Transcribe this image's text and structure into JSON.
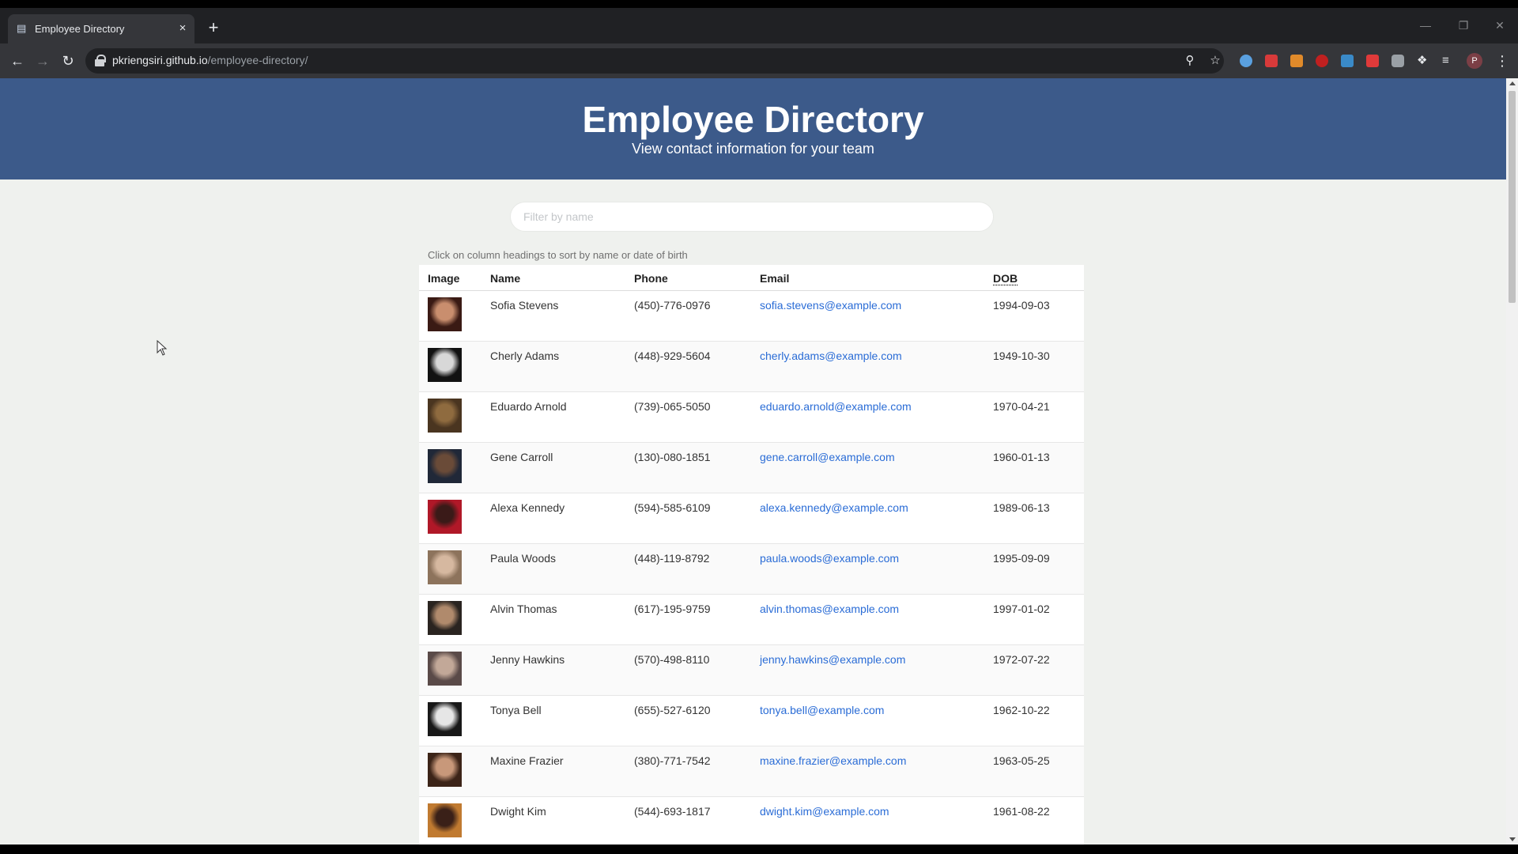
{
  "browser": {
    "tab_title": "Employee Directory",
    "tab_close": "×",
    "new_tab": "+",
    "url_host": "pkriengsiri.github.io",
    "url_path": "/employee-directory/",
    "profile_initial": "P",
    "window_min": "—",
    "window_restore": "❐",
    "window_close": "✕"
  },
  "page": {
    "title": "Employee Directory",
    "subtitle": "View contact information for your team",
    "search_placeholder": "Filter by name",
    "search_value": "",
    "hint": "Click on column headings to sort by name or date of birth"
  },
  "table": {
    "headers": {
      "image": "Image",
      "name": "Name",
      "phone": "Phone",
      "email": "Email",
      "dob": "DOB"
    },
    "rows": [
      {
        "name": "Sofia Stevens",
        "phone": "(450)-776-0976",
        "email": "sofia.stevens@example.com",
        "dob": "1994-09-03",
        "avatar_colors": [
          "#3a1a14",
          "#c98e6e"
        ]
      },
      {
        "name": "Cherly Adams",
        "phone": "(448)-929-5604",
        "email": "cherly.adams@example.com",
        "dob": "1949-10-30",
        "avatar_colors": [
          "#121212",
          "#d8d8d8"
        ]
      },
      {
        "name": "Eduardo Arnold",
        "phone": "(739)-065-5050",
        "email": "eduardo.arnold@example.com",
        "dob": "1970-04-21",
        "avatar_colors": [
          "#4a3520",
          "#8f6b3f"
        ]
      },
      {
        "name": "Gene Carroll",
        "phone": "(130)-080-1851",
        "email": "gene.carroll@example.com",
        "dob": "1960-01-13",
        "avatar_colors": [
          "#202838",
          "#6a4b38"
        ]
      },
      {
        "name": "Alexa Kennedy",
        "phone": "(594)-585-6109",
        "email": "alexa.kennedy@example.com",
        "dob": "1989-06-13",
        "avatar_colors": [
          "#b01828",
          "#3a1a18"
        ]
      },
      {
        "name": "Paula Woods",
        "phone": "(448)-119-8792",
        "email": "paula.woods@example.com",
        "dob": "1995-09-09",
        "avatar_colors": [
          "#8d735c",
          "#d6b8a0"
        ]
      },
      {
        "name": "Alvin Thomas",
        "phone": "(617)-195-9759",
        "email": "alvin.thomas@example.com",
        "dob": "1997-01-02",
        "avatar_colors": [
          "#2a2420",
          "#b08a6c"
        ]
      },
      {
        "name": "Jenny Hawkins",
        "phone": "(570)-498-8110",
        "email": "jenny.hawkins@example.com",
        "dob": "1972-07-22",
        "avatar_colors": [
          "#5a4a48",
          "#c2a898"
        ]
      },
      {
        "name": "Tonya Bell",
        "phone": "(655)-527-6120",
        "email": "tonya.bell@example.com",
        "dob": "1962-10-22",
        "avatar_colors": [
          "#181818",
          "#e6e6e6"
        ]
      },
      {
        "name": "Maxine Frazier",
        "phone": "(380)-771-7542",
        "email": "maxine.frazier@example.com",
        "dob": "1963-05-25",
        "avatar_colors": [
          "#3c2418",
          "#c8987a"
        ]
      },
      {
        "name": "Dwight Kim",
        "phone": "(544)-693-1817",
        "email": "dwight.kim@example.com",
        "dob": "1961-08-22",
        "avatar_colors": [
          "#c07a30",
          "#3a2018"
        ]
      }
    ]
  },
  "colors": {
    "header_bg": "#3c5a8a",
    "page_bg": "#eff1ee",
    "link": "#2a6cd6"
  }
}
